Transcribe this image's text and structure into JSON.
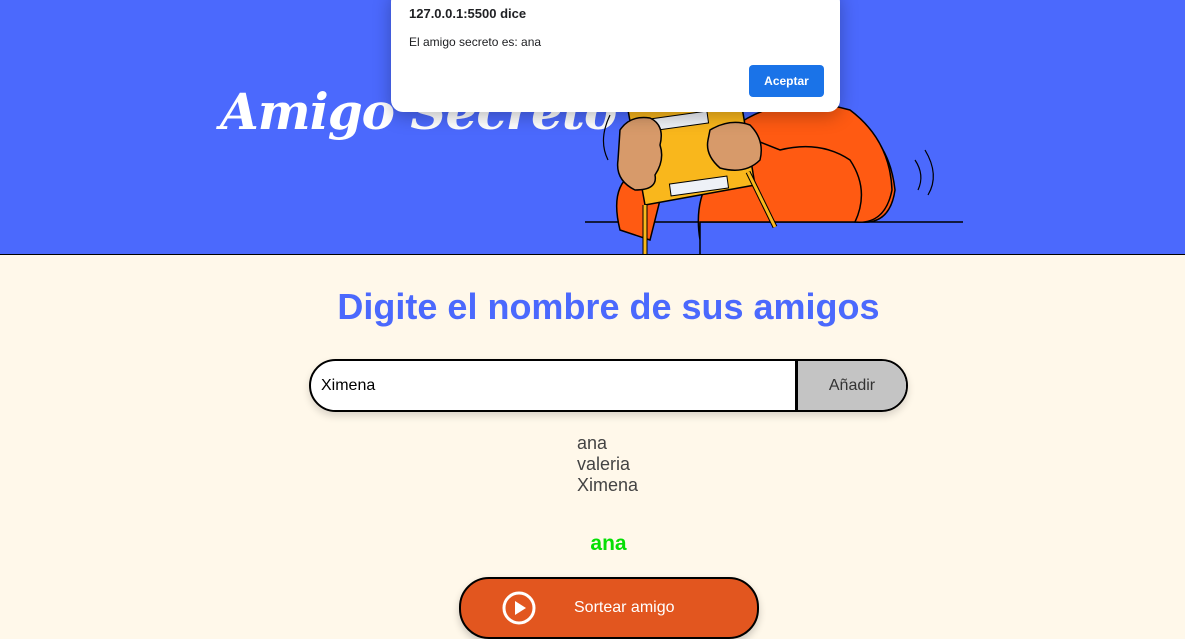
{
  "header": {
    "title": "Amigo Secreto"
  },
  "dialog": {
    "origin": "127.0.0.1:5500 dice",
    "message": "El amigo secreto es: ana",
    "accept_label": "Aceptar"
  },
  "main": {
    "title": "Digite el nombre de sus amigos",
    "input": {
      "value": "Ximena"
    },
    "add_label": "Añadir",
    "friends": [
      "ana",
      "valeria",
      "Ximena"
    ],
    "result": "ana",
    "draw_label": "Sortear amigo"
  },
  "colors": {
    "header_bg": "#4b69fd",
    "page_bg": "#fff8ea",
    "title": "#4b69fd",
    "result": "#05df05",
    "draw_button": "#e2561f",
    "dialog_button": "#1a73e8"
  }
}
